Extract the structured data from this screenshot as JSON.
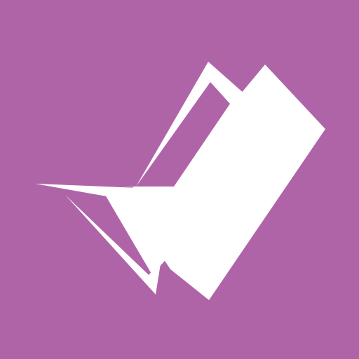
{
  "icon": {
    "name": "check-mark-logo-icon",
    "background_color": "#b064a8",
    "foreground_color": "#ffffff"
  }
}
